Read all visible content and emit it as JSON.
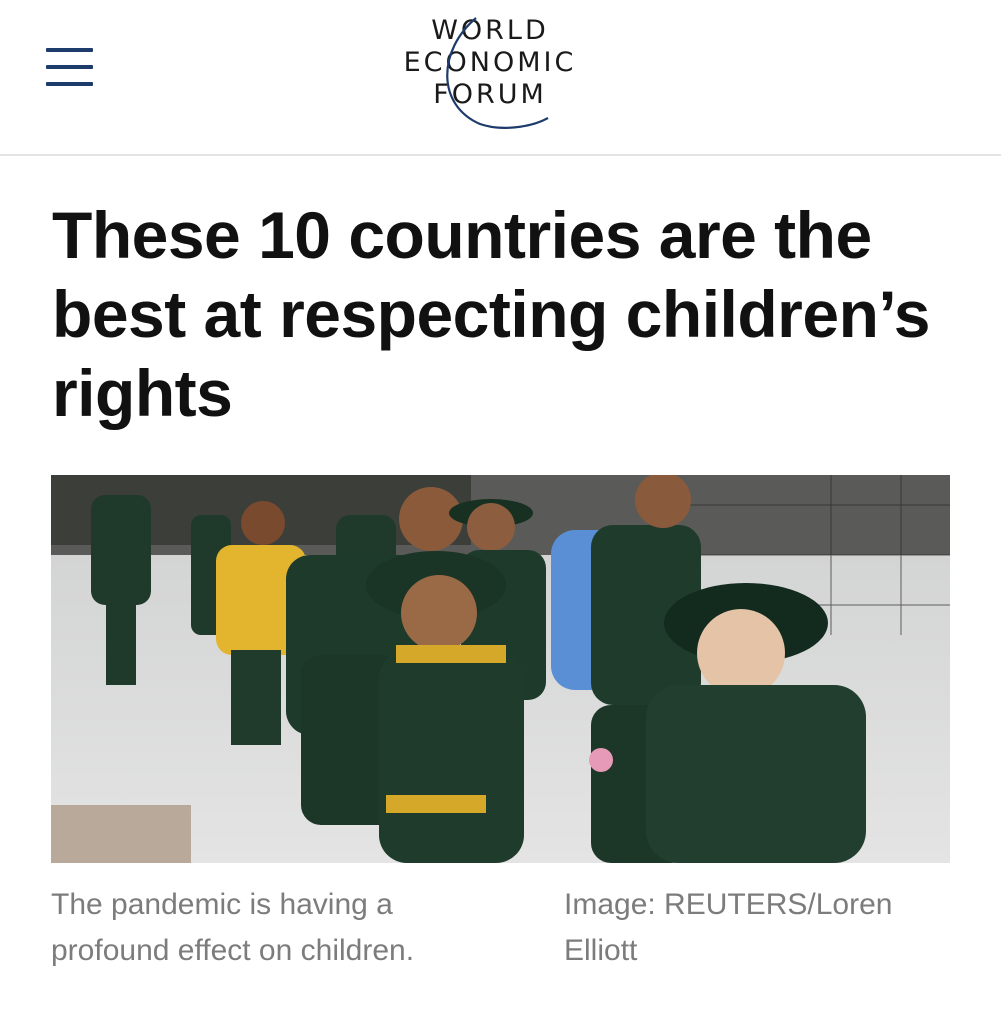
{
  "header": {
    "logo": {
      "line1": "WORLD",
      "line2": "ECONOMIC",
      "line3": "FORUM"
    },
    "colors": {
      "brand_navy": "#1d3b6b",
      "menu_icon": "#1d3b6b"
    }
  },
  "article": {
    "title": "These 10 countries are the best at respecting children’s rights",
    "image": {
      "subject": "Schoolchildren in green uniforms and wide-brimmed hats walking with backpacks"
    },
    "caption": "The pandemic is having a profound effect on children.",
    "credit": "Image: REUTERS/Loren Elliott"
  },
  "icons": {
    "menu": "hamburger-menu-icon",
    "logo_arc": "logo-arc-icon"
  }
}
